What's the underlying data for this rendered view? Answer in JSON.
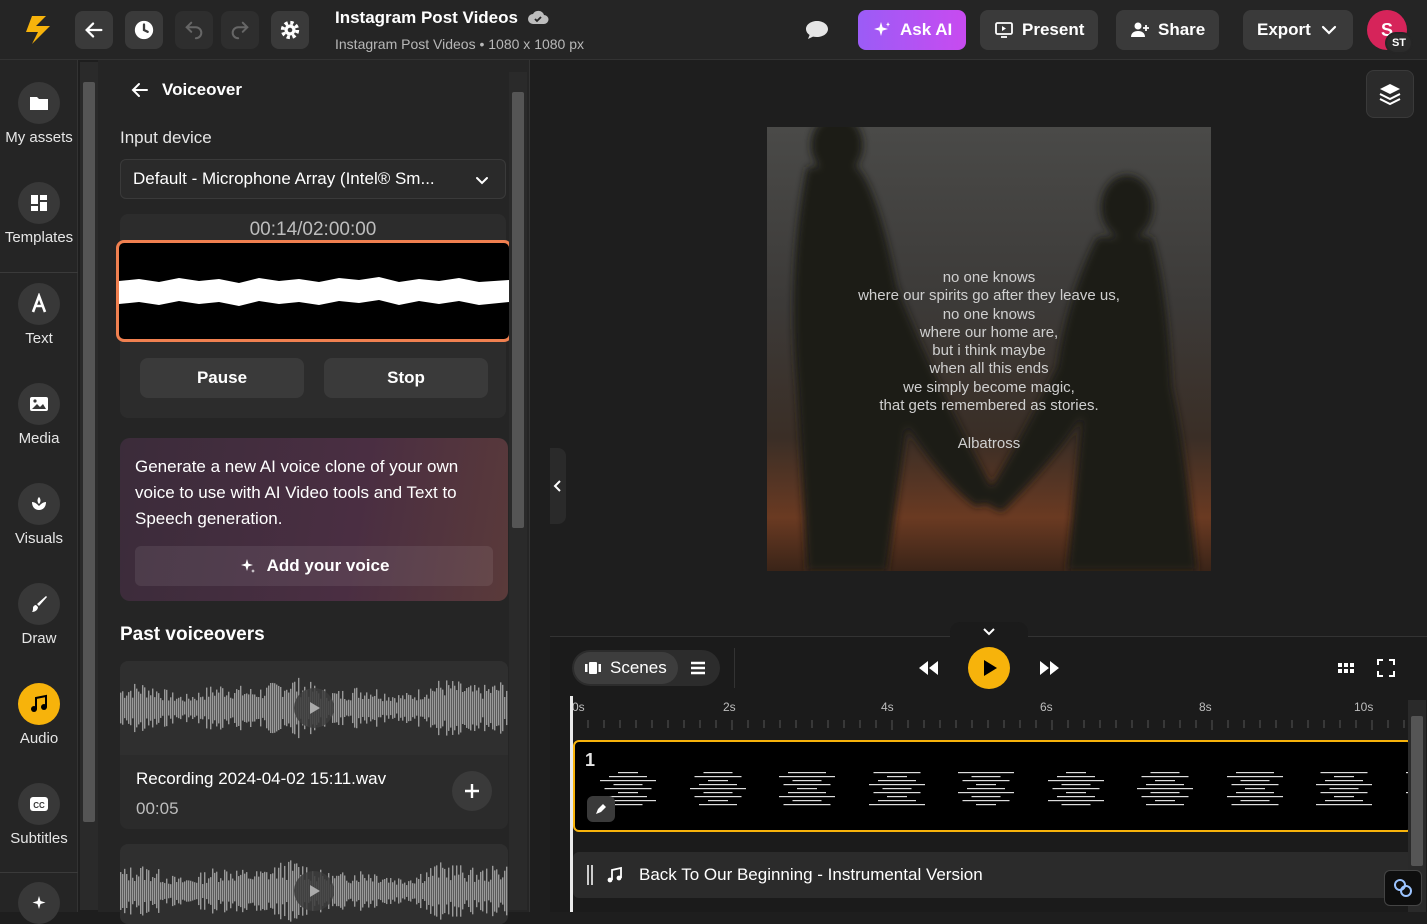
{
  "header": {
    "title": "Instagram Post Videos",
    "subtitle": "Instagram Post Videos • 1080 x 1080 px",
    "ask_ai": "Ask AI",
    "present": "Present",
    "share": "Share",
    "export": "Export",
    "avatar_initial": "S",
    "avatar_badge": "ST"
  },
  "sidebar": {
    "items": [
      {
        "label": "My assets",
        "icon": "folder-icon"
      },
      {
        "label": "Templates",
        "icon": "templates-icon"
      },
      {
        "label": "Text",
        "icon": "text-icon"
      },
      {
        "label": "Media",
        "icon": "image-icon"
      },
      {
        "label": "Visuals",
        "icon": "visuals-icon"
      },
      {
        "label": "Draw",
        "icon": "brush-icon"
      },
      {
        "label": "Audio",
        "icon": "music-icon"
      },
      {
        "label": "Subtitles",
        "icon": "cc-icon"
      }
    ]
  },
  "panel": {
    "back_label": "Voiceover",
    "input_device_label": "Input device",
    "input_device_value": "Default - Microphone Array (Intel® Sm...",
    "timer": "00:14/02:00:00",
    "pause": "Pause",
    "stop": "Stop",
    "promo_text": "Generate a new AI voice clone of your own voice to use with AI Video tools and Text to Speech generation.",
    "promo_button": "Add your voice",
    "past_title": "Past voiceovers",
    "past": [
      {
        "name": "Recording 2024-04-02 15:11.wav",
        "duration": "00:05"
      },
      {
        "name": "",
        "duration": ""
      }
    ]
  },
  "preview": {
    "poem_lines": [
      "no one knows",
      "where our spirits go after they leave us,",
      "no one knows",
      "where our home are,",
      "but i think maybe",
      "when all this ends",
      "we simply become magic,",
      "that gets remembered as stories."
    ],
    "author": "Albatross"
  },
  "timeline": {
    "scenes_label": "Scenes",
    "ticks": [
      "0s",
      "2s",
      "4s",
      "6s",
      "8s",
      "10s"
    ],
    "scene_number": "1",
    "audio_track": "Back To Our Beginning - Instrumental Version"
  },
  "colors": {
    "accent": "#f7b30b",
    "recording_border": "#f08050",
    "ask_ai_gradient": [
      "#9b5cf6",
      "#c84bf0"
    ],
    "avatar": "#d6245a"
  }
}
